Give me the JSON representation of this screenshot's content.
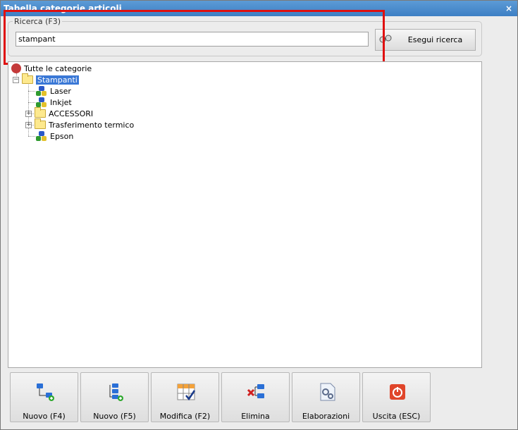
{
  "window": {
    "title": "Tabella categorie articoli",
    "close_glyph": "×"
  },
  "search": {
    "legend": "Ricerca (F3)",
    "value": "stampant",
    "placeholder": "",
    "button_label": "Esegui ricerca",
    "button_icon": "binoculars-icon"
  },
  "tree": {
    "root_label": "Tutte le categorie",
    "selected_label": "Stampanti",
    "items": [
      {
        "label": "Laser",
        "type": "leaf"
      },
      {
        "label": "Inkjet",
        "type": "leaf"
      },
      {
        "label": "ACCESSORI",
        "type": "folder"
      },
      {
        "label": "Trasferimento termico",
        "type": "folder"
      },
      {
        "label": "Epson",
        "type": "leaf"
      }
    ]
  },
  "toolbar": {
    "buttons": [
      {
        "label": "Nuovo (F4)",
        "icon": "new-category-icon"
      },
      {
        "label": "Nuovo (F5)",
        "icon": "new-subcategory-icon"
      },
      {
        "label": "Modifica (F2)",
        "icon": "edit-icon"
      },
      {
        "label": "Elimina",
        "icon": "delete-icon"
      },
      {
        "label": "Elaborazioni",
        "icon": "process-icon"
      },
      {
        "label": "Uscita (ESC)",
        "icon": "exit-icon"
      }
    ]
  },
  "colors": {
    "highlight": "#e01010",
    "selection": "#3a78d6"
  }
}
